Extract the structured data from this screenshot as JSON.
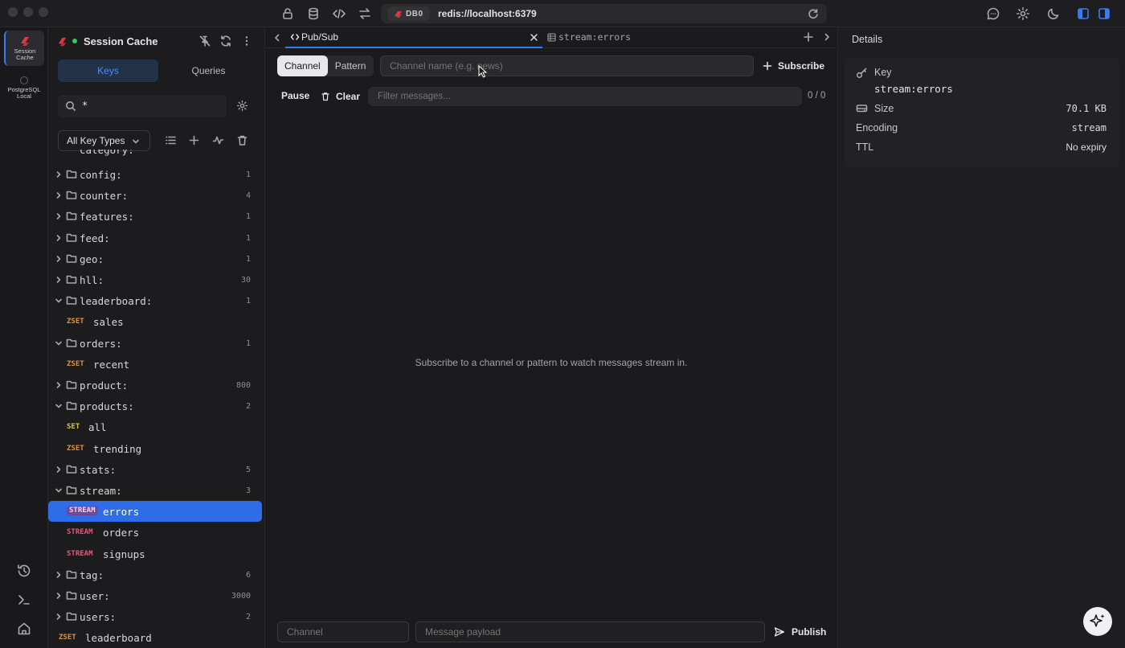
{
  "titlebar": {
    "db_chip": "DB0",
    "url": "redis://localhost:6379"
  },
  "rail": {
    "connections": [
      {
        "label_line1": "Session",
        "label_line2": "Cache"
      },
      {
        "label_line1": "PostgreSQL",
        "label_line2": "Local"
      }
    ]
  },
  "sidebar": {
    "connection_name": "Session Cache",
    "segments": [
      "Keys",
      "Queries"
    ],
    "search_value": "*",
    "type_filter": "All Key Types",
    "partial_row": "category:",
    "tree": [
      {
        "kind": "folder",
        "name": "config:",
        "count": "1",
        "open": false
      },
      {
        "kind": "folder",
        "name": "counter:",
        "count": "4",
        "open": false
      },
      {
        "kind": "folder",
        "name": "features:",
        "count": "1",
        "open": false
      },
      {
        "kind": "folder",
        "name": "feed:",
        "count": "1",
        "open": false
      },
      {
        "kind": "folder",
        "name": "geo:",
        "count": "1",
        "open": false
      },
      {
        "kind": "folder",
        "name": "hll:",
        "count": "30",
        "open": false
      },
      {
        "kind": "folder",
        "name": "leaderboard:",
        "count": "1",
        "open": true
      },
      {
        "kind": "key",
        "type": "ZSET",
        "name": "sales"
      },
      {
        "kind": "folder",
        "name": "orders:",
        "count": "1",
        "open": true
      },
      {
        "kind": "key",
        "type": "ZSET",
        "name": "recent"
      },
      {
        "kind": "folder",
        "name": "product:",
        "count": "800",
        "open": false
      },
      {
        "kind": "folder",
        "name": "products:",
        "count": "2",
        "open": true
      },
      {
        "kind": "key",
        "type": "SET",
        "name": "all"
      },
      {
        "kind": "key",
        "type": "ZSET",
        "name": "trending"
      },
      {
        "kind": "folder",
        "name": "stats:",
        "count": "5",
        "open": false
      },
      {
        "kind": "folder",
        "name": "stream:",
        "count": "3",
        "open": true
      },
      {
        "kind": "key",
        "type": "STREAM",
        "name": "errors",
        "selected": true
      },
      {
        "kind": "key",
        "type": "STREAM",
        "name": "orders"
      },
      {
        "kind": "key",
        "type": "STREAM",
        "name": "signups"
      },
      {
        "kind": "folder",
        "name": "tag:",
        "count": "6",
        "open": false
      },
      {
        "kind": "folder",
        "name": "user:",
        "count": "3000",
        "open": false
      },
      {
        "kind": "folder",
        "name": "users:",
        "count": "2",
        "open": false
      },
      {
        "kind": "rootkey",
        "type": "ZSET",
        "name": "leaderboard"
      }
    ]
  },
  "main": {
    "tabs": [
      {
        "label": "Pub/Sub"
      },
      {
        "label": "stream:errors"
      }
    ],
    "mode_channel": "Channel",
    "mode_pattern": "Pattern",
    "channel_placeholder": "Channel name (e.g. news)",
    "subscribe_label": "Subscribe",
    "pause_label": "Pause",
    "clear_label": "Clear",
    "filter_placeholder": "Filter messages...",
    "message_count": "0 / 0",
    "empty_message": "Subscribe to a channel or pattern to watch messages stream in.",
    "publish_channel_placeholder": "Channel",
    "publish_payload_placeholder": "Message payload",
    "publish_label": "Publish"
  },
  "details": {
    "title": "Details",
    "key_label": "Key",
    "key_value": "stream:errors",
    "size_label": "Size",
    "size_value": "70.1 KB",
    "encoding_label": "Encoding",
    "encoding_value": "stream",
    "ttl_label": "TTL",
    "ttl_value": "No expiry"
  },
  "colors": {
    "accent": "#3a7bf5",
    "selected_row": "#2f6de8",
    "zset_badge": "#e0903a",
    "set_badge": "#e0c13a",
    "stream_badge": "#e05a7a",
    "logo": "#e0393e"
  }
}
